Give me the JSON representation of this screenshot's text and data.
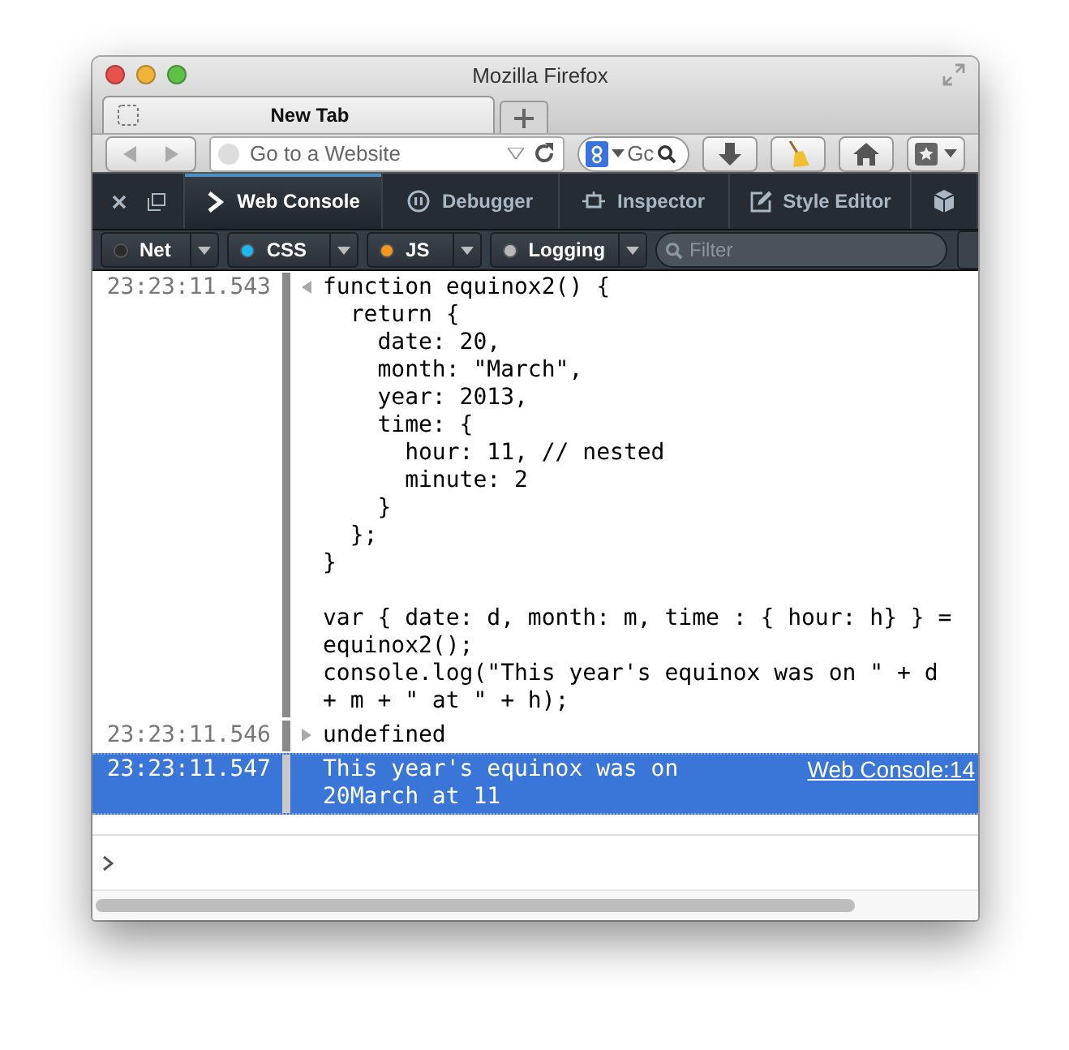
{
  "window": {
    "title": "Mozilla Firefox"
  },
  "tabs": [
    {
      "label": "New Tab",
      "selected": true
    }
  ],
  "navbar": {
    "url_placeholder": "Go to a Website",
    "search_text": "Gc"
  },
  "devtools_tabs": [
    {
      "label": "Web Console",
      "kind": "console",
      "selected": true
    },
    {
      "label": "Debugger",
      "kind": "debugger",
      "selected": false
    },
    {
      "label": "Inspector",
      "kind": "inspector",
      "selected": false
    },
    {
      "label": "Style Editor",
      "kind": "style-editor",
      "selected": false
    }
  ],
  "filters": [
    {
      "label": "Net",
      "color": "#2b2b2b"
    },
    {
      "label": "CSS",
      "color": "#1db7f2"
    },
    {
      "label": "JS",
      "color": "#f7961e"
    },
    {
      "label": "Logging",
      "color": "#b8b8b8"
    }
  ],
  "filter_placeholder": "Filter",
  "messages": [
    {
      "time": "23:23:11.543",
      "kind": "input",
      "selected": false,
      "text": "function equinox2() {\n  return {\n    date: 20,\n    month: \"March\",\n    year: 2013,\n    time: {\n      hour: 11, // nested\n      minute: 2\n    }\n  };\n}\n\nvar { date: d, month: m, time : { hour: h} } =\nequinox2();\nconsole.log(\"This year's equinox was on \" + d\n+ m + \" at \" + h);"
    },
    {
      "time": "23:23:11.546",
      "kind": "output",
      "selected": false,
      "text": "undefined"
    },
    {
      "time": "23:23:11.547",
      "kind": "log",
      "selected": true,
      "text": "This year's equinox was on 20March at 11",
      "source": "Web Console:14"
    }
  ]
}
